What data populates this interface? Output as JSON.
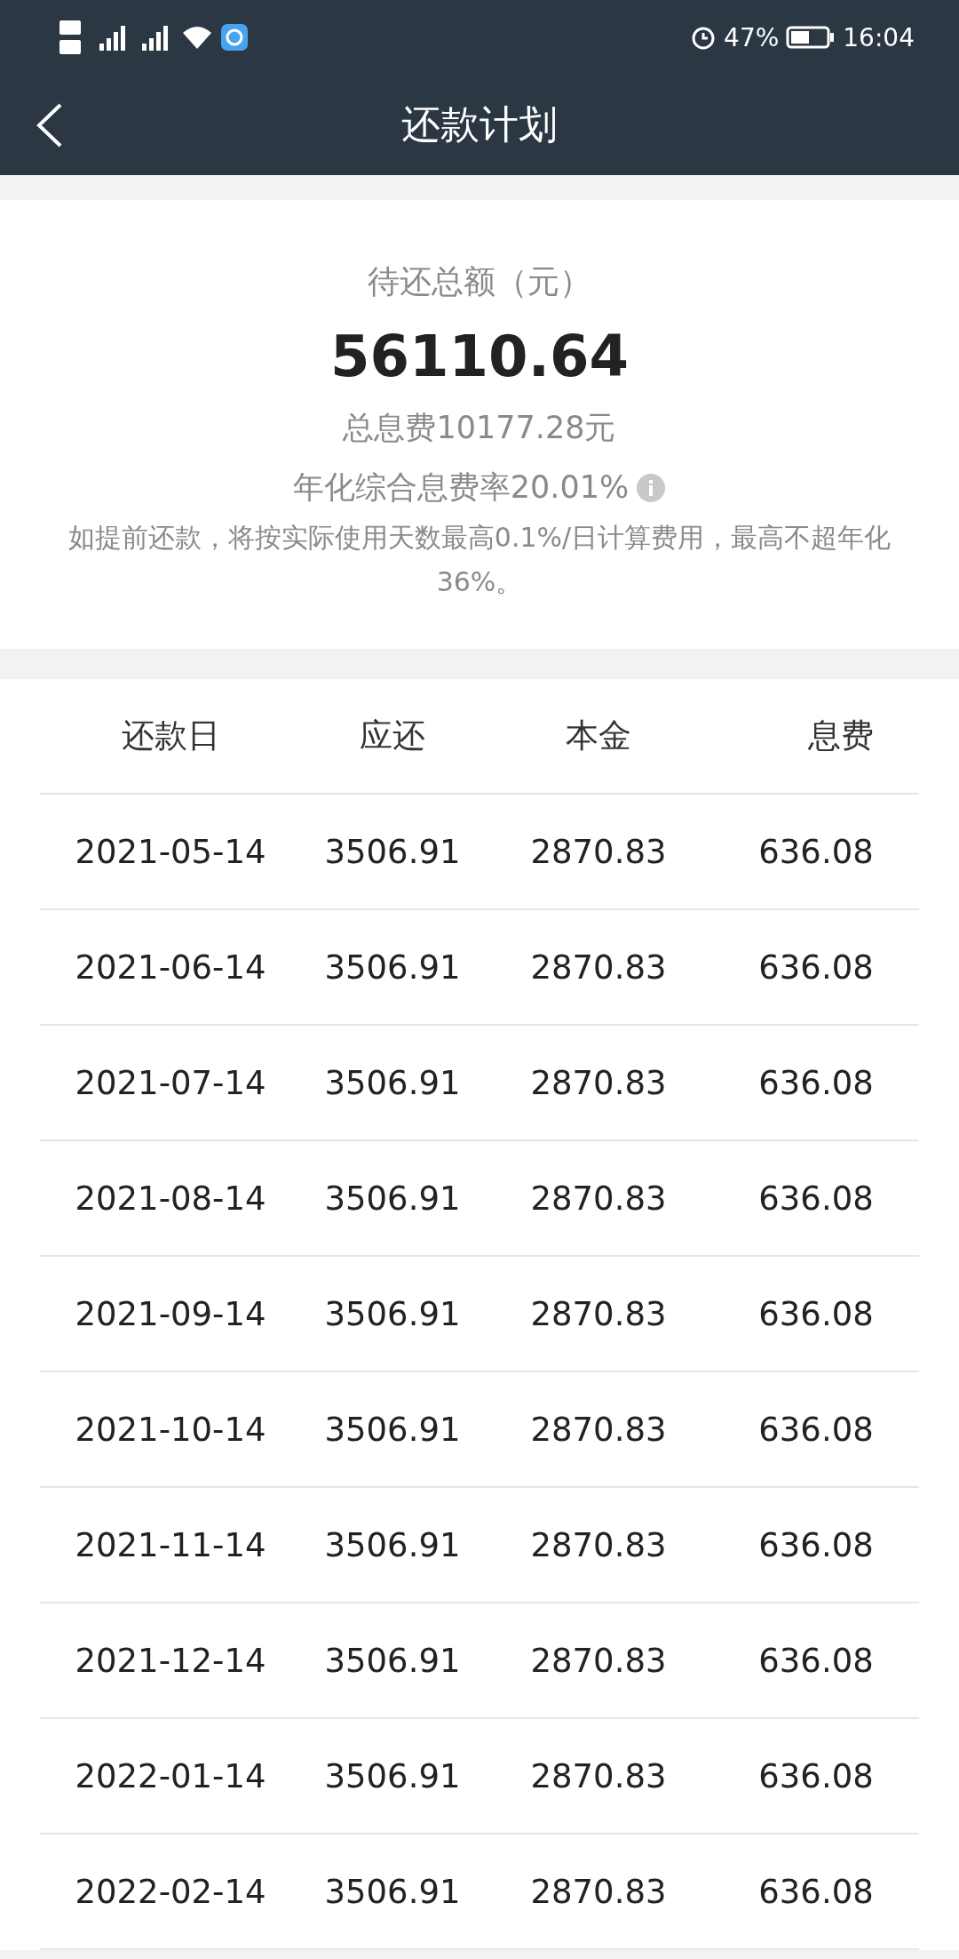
{
  "status_bar": {
    "battery": "47%",
    "time": "16:04"
  },
  "header": {
    "title": "还款计划"
  },
  "summary": {
    "label": "待还总额（元）",
    "amount": "56110.64",
    "total_fee": "总息费10177.28元",
    "annual_rate": "年化综合息费率20.01%",
    "note": "如提前还款，将按实际使用天数最高0.1%/日计算费用，最高不超年化36%。"
  },
  "table": {
    "columns": [
      "还款日",
      "应还",
      "本金",
      "息费"
    ],
    "rows": [
      [
        "2021-05-14",
        "3506.91",
        "2870.83",
        "636.08"
      ],
      [
        "2021-06-14",
        "3506.91",
        "2870.83",
        "636.08"
      ],
      [
        "2021-07-14",
        "3506.91",
        "2870.83",
        "636.08"
      ],
      [
        "2021-08-14",
        "3506.91",
        "2870.83",
        "636.08"
      ],
      [
        "2021-09-14",
        "3506.91",
        "2870.83",
        "636.08"
      ],
      [
        "2021-10-14",
        "3506.91",
        "2870.83",
        "636.08"
      ],
      [
        "2021-11-14",
        "3506.91",
        "2870.83",
        "636.08"
      ],
      [
        "2021-12-14",
        "3506.91",
        "2870.83",
        "636.08"
      ],
      [
        "2022-01-14",
        "3506.91",
        "2870.83",
        "636.08"
      ],
      [
        "2022-02-14",
        "3506.91",
        "2870.83",
        "636.08"
      ]
    ]
  }
}
